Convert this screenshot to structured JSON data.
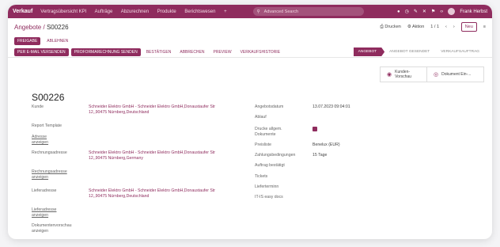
{
  "nav": {
    "brand": "Verkauf",
    "menu": [
      "Vertragsübersicht KPI",
      "Aufträge",
      "Abzurechnen",
      "Produkte",
      "Berichtswesen",
      "+"
    ],
    "search_placeholder": "Advanced Search",
    "user": "Frank Herbst"
  },
  "control": {
    "breadcrumb_parent": "Angebote",
    "breadcrumb_sep": " / ",
    "breadcrumb_current": "S00226",
    "print_label": "Drucken",
    "action_label": "Aktion",
    "pager": "1 / 1",
    "new_label": "Neu"
  },
  "tabs": {
    "freigabe": "FREIGABE",
    "ablehnen": "ABLEHNEN"
  },
  "actions": [
    "PER E-MAIL VERSENDEN",
    "PROFORMARECHNUNG SENDEN",
    "BESTÄTIGEN",
    "ABBRECHEN",
    "PREVIEW",
    "VERKAUFSHISTORIE"
  ],
  "statusbar": [
    "ANGEBOT",
    "ANGEBOT GESENDET",
    "VERKAUFSAUFTRAG"
  ],
  "smart_buttons": {
    "preview": "Kunden-Vorschau",
    "doc": "Dokument Ein-..."
  },
  "form": {
    "title": "S00226",
    "kunde_label": "Kunde",
    "kunde_value": "Schneider Elektro GmbH - Schneider Elektro GmbH,Donaustaufer Str 12,,90475 Nürnberg,Deutschland",
    "report_label": "Report Template",
    "adresse_link": "Adresse anzeigen",
    "rechnungsadresse_label": "Rechnungsadresse",
    "rechnungsadresse_value": "Schneider Elektro GmbH - Schneider Elektro GmbH,Donaustaufer Str 12,,90475 Nürnberg,Germany",
    "rechnungsadresse_link": "Rechnungsadresse anzeigen",
    "lieferadresse_label": "Lieferadresse",
    "lieferadresse_value": "Schneider Elektro GmbH - Schneider Elektro GmbH,Donaustaufer Str 12,,90475 Nürnberg,Deutschland",
    "lieferadresse_link": "Lieferadresse anzeigen",
    "vorschau_label": "Dokumentenvorschau anzeigen",
    "angebotsdatum_label": "Angebotsdatum",
    "angebotsdatum_value": "13.07.2023 09:04:01",
    "ablauf_label": "Ablauf",
    "drucke_label": "Drucke allgem. Dokumente",
    "preisliste_label": "Preisliste",
    "preisliste_value": "Benelux (EUR)",
    "zahlung_label": "Zahlungsbedingungen",
    "zahlung_value": "15 Tage",
    "auftrag_label": "Auftrag bestätigt",
    "tickets_label": "Tickets",
    "lieferterm_label": "Lieferterminn",
    "itis_label": "IT-IS easy docs"
  }
}
